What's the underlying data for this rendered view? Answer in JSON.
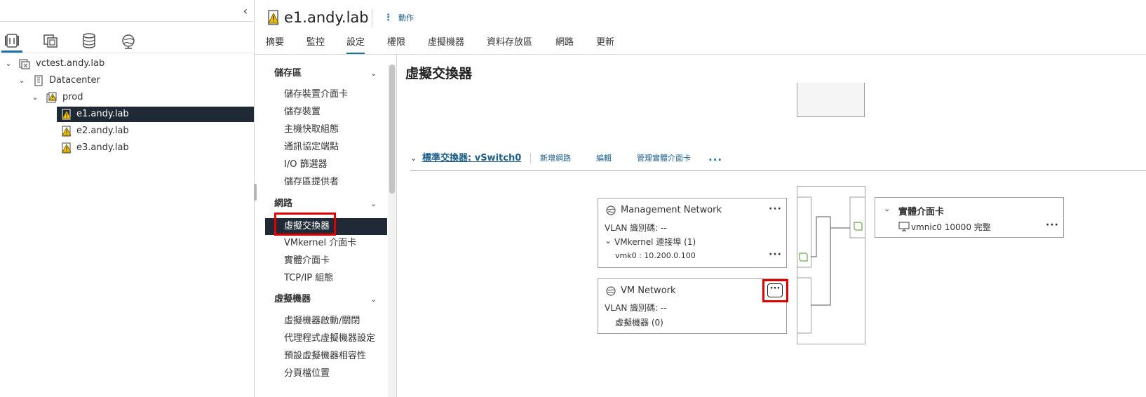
{
  "navigator": {
    "collapse_icon": "chevron-left-icon",
    "view_icons": [
      "hosts-and-clusters-icon",
      "vms-and-templates-icon",
      "storage-icon",
      "networking-icon"
    ],
    "tree": {
      "vcenter": "vctest.andy.lab",
      "datacenter": "Datacenter",
      "cluster": "prod",
      "hosts": [
        "e1.andy.lab",
        "e2.andy.lab",
        "e3.andy.lab"
      ],
      "selected_host": "e1.andy.lab"
    }
  },
  "header": {
    "object_title": "e1.andy.lab",
    "actions_label": "動作",
    "tabs": [
      "摘要",
      "監控",
      "設定",
      "權限",
      "虛擬機器",
      "資料存放區",
      "網路",
      "更新"
    ],
    "active_tab": "設定"
  },
  "submenu": {
    "sections": [
      {
        "label": "儲存區",
        "items": [
          "儲存裝置介面卡",
          "儲存裝置",
          "主機快取組態",
          "通訊協定端點",
          "I/O 篩選器",
          "儲存區提供者"
        ]
      },
      {
        "label": "網路",
        "items": [
          "虛擬交換器",
          "VMkernel 介面卡",
          "實體介面卡",
          "TCP/IP 組態"
        ]
      },
      {
        "label": "虛擬機器",
        "items": [
          "虛擬機器啟動/關閉",
          "代理程式虛擬機器設定",
          "預設虛擬機器相容性",
          "分頁檔位置"
        ]
      }
    ],
    "selected_item": "虛擬交換器"
  },
  "main": {
    "title": "虛擬交換器",
    "switch": {
      "title": "標準交換器: vSwitch0",
      "actions": [
        "新增網路",
        "編輯",
        "管理實體介面卡"
      ],
      "more": "..."
    },
    "port_groups": [
      {
        "name": "Management Network",
        "vlan": "VLAN 識別碼: --",
        "vmkernel_ports": "VMkernel 連接埠 (1)",
        "vmk": "vmk0 : 10.200.0.100"
      },
      {
        "name": "VM Network",
        "vlan": "VLAN 識別碼: --",
        "vms": "虛擬機器 (0)"
      }
    ],
    "physical_adapters": {
      "title": "實體介面卡",
      "item": "vmnic0 10000 完整"
    }
  },
  "colors": {
    "accent": "#1b6ea6",
    "selected_bg": "#1f2a36",
    "highlight_red": "#e10000",
    "warning_yellow": "#f0c000"
  }
}
